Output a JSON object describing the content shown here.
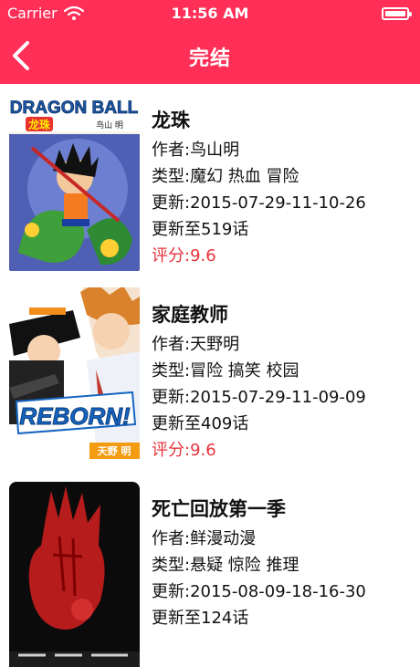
{
  "status_bar": {
    "carrier": "Carrier",
    "time": "11:56 AM"
  },
  "nav": {
    "title": "完结",
    "back_icon": "chevron-left-icon"
  },
  "colors": {
    "accent": "#ff2f57",
    "score": "#e8323c"
  },
  "comics": [
    {
      "name": "龙珠",
      "author": "作者:鸟山明",
      "genre": "类型:魔幻 热血 冒险",
      "updated": "更新:2015-07-29-11-10-26",
      "latest": "更新至519话",
      "score": "评分:9.6",
      "cover": {
        "logo": "DRAGON BALL",
        "sub": "龙珠",
        "author": "鸟山 明"
      }
    },
    {
      "name": "家庭教师",
      "author": "作者:天野明",
      "genre": "类型:冒险 搞笑 校园",
      "updated": "更新:2015-07-29-11-09-09",
      "latest": "更新至409话",
      "score": "评分:9.6",
      "cover": {
        "logo": "REBORN!",
        "author": "天野 明"
      }
    },
    {
      "name": "死亡回放第一季",
      "author": "作者:鲜漫动漫",
      "genre": "类型:悬疑 惊险 推理",
      "updated": "更新:2015-08-09-18-16-30",
      "latest": "更新至124话",
      "score": "",
      "cover": {}
    }
  ]
}
